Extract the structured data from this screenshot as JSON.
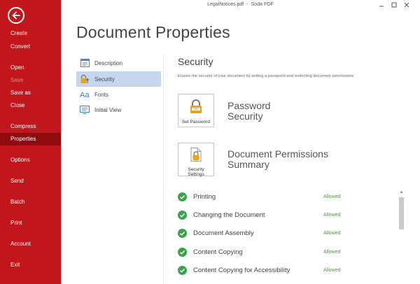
{
  "window": {
    "file_name": "LegalNotices.pdf",
    "separator": "-",
    "app_name": "Soda PDF"
  },
  "sidebar": {
    "items": [
      {
        "label": "Create"
      },
      {
        "label": "Convert"
      },
      {
        "label": "Open"
      },
      {
        "label": "Save"
      },
      {
        "label": "Save as"
      },
      {
        "label": "Close"
      },
      {
        "label": "Compress"
      },
      {
        "label": "Properties"
      },
      {
        "label": "Options"
      },
      {
        "label": "Send"
      },
      {
        "label": "Batch"
      },
      {
        "label": "Print"
      },
      {
        "label": "Account"
      },
      {
        "label": "Exit"
      }
    ]
  },
  "page": {
    "title": "Document Properties"
  },
  "nav": {
    "items": [
      {
        "label": "Description",
        "icon": "description-icon"
      },
      {
        "label": "Security",
        "icon": "lock-key-icon"
      },
      {
        "label": "Fonts",
        "icon": "fonts-icon"
      },
      {
        "label": "Initial View",
        "icon": "monitor-icon"
      }
    ]
  },
  "security": {
    "title": "Security",
    "description": "Ensure the security of your document by setting a password and restricting document permissions",
    "set_password_label": "Set Password",
    "password_heading_line1": "Password",
    "password_heading_line2": "Security",
    "security_settings_line1": "Security",
    "security_settings_line2": "Settings",
    "permissions_heading_line1": "Document Permissions",
    "permissions_heading_line2": "Summary"
  },
  "permissions": [
    {
      "name": "Printing",
      "status": "Allowed"
    },
    {
      "name": "Changing the Document",
      "status": "Allowed"
    },
    {
      "name": "Document Assembly",
      "status": "Allowed"
    },
    {
      "name": "Content Copying",
      "status": "Allowed"
    },
    {
      "name": "Content Copying for Accessibility",
      "status": "Allowed"
    }
  ],
  "colors": {
    "sidebar_bg": "#c3161c",
    "sidebar_active": "#8e0c10",
    "nav_active": "#c5d7ee",
    "allowed_green": "#4a9c2d",
    "check_green": "#3aa34a",
    "lock_gold": "#e8a317"
  }
}
